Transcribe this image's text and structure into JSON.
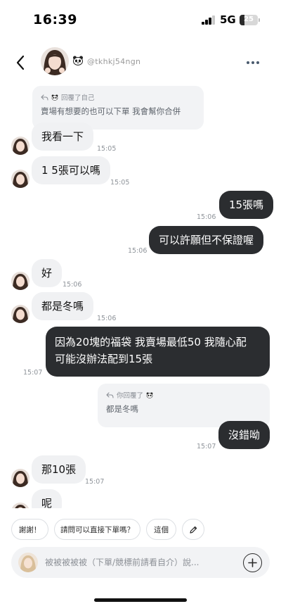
{
  "status_bar": {
    "time": "16:39",
    "network": "5G",
    "battery": "25",
    "battery_level": 0.25
  },
  "header": {
    "username": "@tkhkj54ngn"
  },
  "messages": {
    "reply1_label": "回覆了自己",
    "reply1_text": "賣場有想要的也可以下單 我會幫你合併",
    "m1": {
      "text": "我看一下",
      "time": "15:05"
    },
    "m2": {
      "text": "1 5張可以嗎",
      "time": "15:05"
    },
    "m3": {
      "text": "15張嗎",
      "time": "15:06"
    },
    "m4": {
      "text": "可以許願但不保證喔",
      "time": "15:06"
    },
    "m5": {
      "text": "好",
      "time": "15:06"
    },
    "m6": {
      "text": "都是冬嗎",
      "time": "15:06"
    },
    "m7": {
      "line1": "因為20塊的福袋 我賣場最低50 我隨心配",
      "line2": "可能沒辦法配到15張",
      "time": "15:07"
    },
    "reply2_label": "你回覆了",
    "reply2_text": "都是冬嗎",
    "m8": {
      "text": "沒錯呦",
      "time": "15:07"
    },
    "m9": {
      "text": "那10張",
      "time": "15:07"
    },
    "m10": {
      "text": "呢"
    }
  },
  "quick_replies": [
    "謝謝！",
    "請問可以直接下單嗎？",
    "這個"
  ],
  "input": {
    "placeholder": "被被被被被（下單/競標前請看自介）說..."
  },
  "colors": {
    "bubble_in": "#f0f1f3",
    "bubble_out": "#2b2d30",
    "accent": "#4a5b6e"
  },
  "icons": [
    "back-chevron-icon",
    "panda-emoji-icon",
    "more-dots-icon",
    "reply-arrow-icon",
    "edit-pencil-icon",
    "add-plus-icon"
  ]
}
